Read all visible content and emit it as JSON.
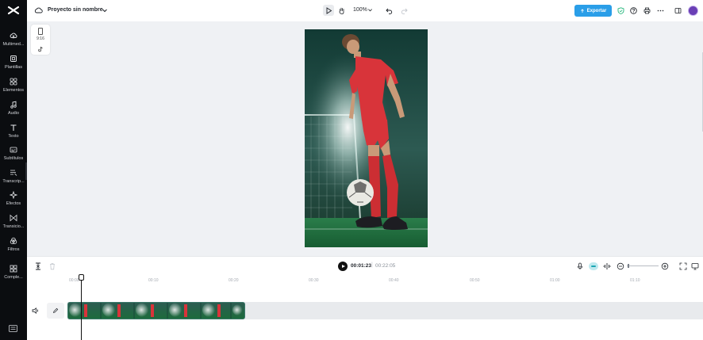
{
  "app": {
    "project_name": "Proyecto sin nombre",
    "zoom": "100%",
    "export_label": "Exportar"
  },
  "sidebar": {
    "items": [
      {
        "label": "Multimed...",
        "icon": "cloud-upload-icon"
      },
      {
        "label": "Plantillas",
        "icon": "template-icon"
      },
      {
        "label": "Elementos",
        "icon": "elements-icon"
      },
      {
        "label": "Audio",
        "icon": "music-note-icon"
      },
      {
        "label": "Texto",
        "icon": "text-icon"
      },
      {
        "label": "Subtítulos",
        "icon": "captions-icon"
      },
      {
        "label": "Transcrip...",
        "icon": "transcript-icon"
      },
      {
        "label": "Efectos",
        "icon": "effects-icon"
      },
      {
        "label": "Transicio...",
        "icon": "transition-icon"
      },
      {
        "label": "Filtros",
        "icon": "filters-icon"
      },
      {
        "label": "Comple...",
        "icon": "plugins-icon"
      }
    ]
  },
  "canvas": {
    "aspect_ratio": "9:16"
  },
  "timeline": {
    "current_time": "00:01:23",
    "separator": "|",
    "total_time": "00:22:05",
    "ruler_labels": [
      "00:00",
      "00:10",
      "00:20",
      "00:30",
      "00:40",
      "00:50",
      "01:00",
      "01:10"
    ]
  },
  "colors": {
    "accent": "#2a9ee8",
    "sidebar_bg": "#0b0d10",
    "canvas_bg": "#eff1f4",
    "shirt_red": "#d8343a",
    "pitch_green": "#1f7a3e"
  }
}
